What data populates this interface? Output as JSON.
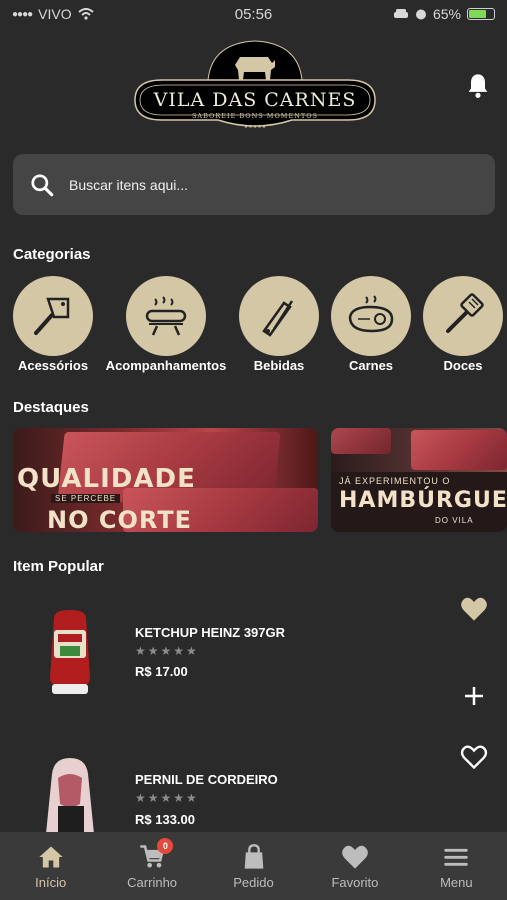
{
  "status": {
    "carrier": "VIVO",
    "time": "05:56",
    "battery": "65%"
  },
  "brand": {
    "name": "VILA DAS CARNES",
    "tagline": "SABOREIE BONS MOMENTOS"
  },
  "search": {
    "placeholder": "Buscar itens aqui..."
  },
  "sections": {
    "categories": "Categorias",
    "highlights": "Destaques",
    "popular": "Item Popular"
  },
  "categories": [
    {
      "label": "Acessórios",
      "icon": "cleaver-icon"
    },
    {
      "label": "Acompanhamentos",
      "icon": "sausage-grill-icon"
    },
    {
      "label": "Bebidas",
      "icon": "tongs-icon"
    },
    {
      "label": "Carnes",
      "icon": "steak-icon"
    },
    {
      "label": "Doces",
      "icon": "spatula-icon"
    }
  ],
  "banners": [
    {
      "line1": "QUALIDADE",
      "line2": "SE PERCEBE",
      "line3": "NO CORTE"
    },
    {
      "line1": "JÁ EXPERIMENTOU O",
      "line2": "HAMBÚRGUER",
      "line3": "DO VILA"
    }
  ],
  "products": [
    {
      "name": "KETCHUP HEINZ 397GR",
      "stars": "★★★★★",
      "price": "R$ 17.00",
      "favorited": true
    },
    {
      "name": "PERNIL DE CORDEIRO",
      "stars": "★★★★★",
      "price": "R$ 133.00",
      "favorited": false
    }
  ],
  "nav": {
    "items": [
      {
        "label": "Início",
        "icon": "home-icon"
      },
      {
        "label": "Carrinho",
        "icon": "cart-icon"
      },
      {
        "label": "Pedido",
        "icon": "bag-icon"
      },
      {
        "label": "Favorito",
        "icon": "heart-icon"
      },
      {
        "label": "Menu",
        "icon": "menu-icon"
      }
    ],
    "cart_count": "0"
  },
  "colors": {
    "accent": "#d4c7a6",
    "background": "#2a2a2a",
    "search_bg": "#454545",
    "badge": "#e44a3b"
  }
}
